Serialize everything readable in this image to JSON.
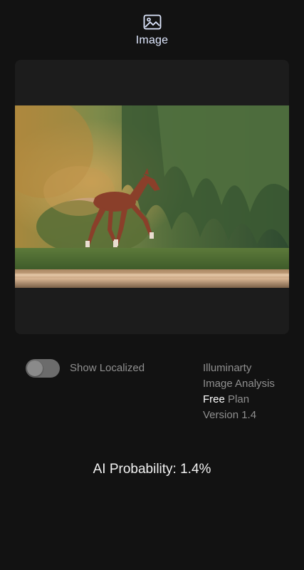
{
  "header": {
    "tab_label": "Image",
    "tab_icon": "image-icon"
  },
  "preview": {
    "description_icon": "photo"
  },
  "controls": {
    "toggle_label": "Show Localized",
    "toggle_on": false
  },
  "info": {
    "line1": "Illuminarty",
    "line2": "Image Analysis",
    "plan_highlight": "Free",
    "plan_suffix": " Plan",
    "version": "Version 1.4"
  },
  "result": {
    "probability_text": "AI Probability: 1.4%"
  },
  "colors": {
    "background": "#121212",
    "card": "#1c1c1c",
    "muted_text": "#8f8f8f",
    "accent_text": "#dfe8ff"
  }
}
